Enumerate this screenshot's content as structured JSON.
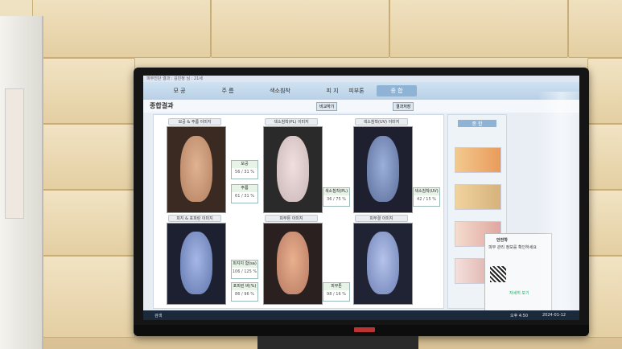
{
  "app": {
    "titlebar": "피부진단 결과 : 김민정 님 : 21세",
    "tabs": [
      "모 공",
      "주 름",
      "색소침착",
      "피 지",
      "피부톤",
      "종 합"
    ],
    "subtitle": "종합결과",
    "toolbar_btn": "비교하기",
    "toolbar_btn2": "결과저장"
  },
  "panel": {
    "captions": [
      "모공 & 주름 이미지",
      "색소침착(PL) 이미지",
      "색소침착(UV) 이미지",
      "피지 & 포피린 이미지",
      "피부톤 이미지",
      "피부결 이미지"
    ],
    "labels": [
      {
        "t": "모공",
        "v": "56 / 31 %"
      },
      {
        "t": "주름",
        "v": "61 / 31 %"
      },
      {
        "t": "색소침착(PL)",
        "v": "36 / 75 %"
      },
      {
        "t": "색소침착(UV)",
        "v": "42 / 15 %"
      },
      {
        "t": "피지지 함(sa)",
        "v": "106 / 125 %"
      },
      {
        "t": "포피린 버(%)",
        "v": "86 / 96 %"
      },
      {
        "t": "피부톤",
        "v": "98 / 16 %"
      }
    ]
  },
  "side": {
    "title": "종 합"
  },
  "notification": {
    "title": "안전학",
    "lines": [
      "피부 관리 정보를 확인하세요",
      "자세히 보기"
    ]
  },
  "taskbar": {
    "left": "검색",
    "time": "오후 4:50",
    "date": "2024-01-12"
  },
  "colors": {
    "bezel": "#151515",
    "screen_bg": "#e9eef5",
    "tab_bar": "#b8d0e6",
    "taskbar": "#1b2a3b",
    "tiles": "#e7d3a9"
  }
}
